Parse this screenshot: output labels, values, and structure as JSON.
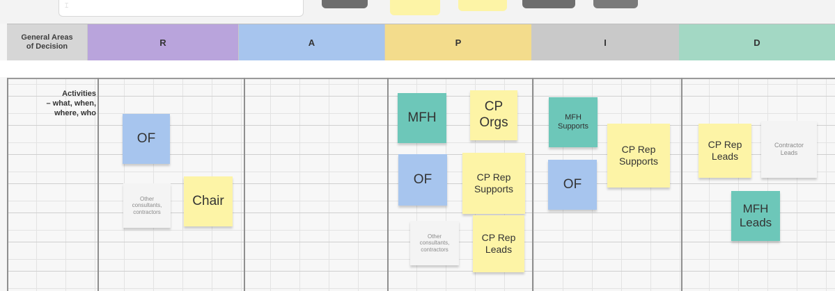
{
  "header": {
    "row_label_line1": "General Areas",
    "row_label_line2": "of Decision",
    "columns": [
      {
        "letter": "R",
        "color": "#b9a4dc"
      },
      {
        "letter": "A",
        "color": "#a7c5ee"
      },
      {
        "letter": "P",
        "color": "#f3dc8c"
      },
      {
        "letter": "I",
        "color": "#c9c9c9"
      },
      {
        "letter": "D",
        "color": "#a3d8c4"
      }
    ]
  },
  "activities_row": {
    "label_line1": "Activities",
    "label_line2": "– what, when,",
    "label_line3": "where, who"
  },
  "notes": {
    "r_of": "OF",
    "r_other_line1": "Other",
    "r_other_line2": "consultants,",
    "r_other_line3": "contractors",
    "r_chair": "Chair",
    "p_mfh": "MFH",
    "p_cp_orgs_line1": "CP",
    "p_cp_orgs_line2": "Orgs",
    "p_of": "OF",
    "p_cp_rep_supports_line1": "CP Rep",
    "p_cp_rep_supports_line2": "Supports",
    "p_other_line1": "Other",
    "p_other_line2": "consultants,",
    "p_other_line3": "contractors",
    "p_cp_rep_leads_line1": "CP Rep",
    "p_cp_rep_leads_line2": "Leads",
    "i_mfh_supports_line1": "MFH",
    "i_mfh_supports_line2": "Supports",
    "i_cp_rep_supports_line1": "CP Rep",
    "i_cp_rep_supports_line2": "Supports",
    "i_of": "OF",
    "d_cp_rep_leads_line1": "CP Rep",
    "d_cp_rep_leads_line2": "Leads",
    "d_contractor_leads_line1": "Contractor",
    "d_contractor_leads_line2": "Leads",
    "d_mfh_leads_line1": "MFH",
    "d_mfh_leads_line2": "Leads"
  }
}
